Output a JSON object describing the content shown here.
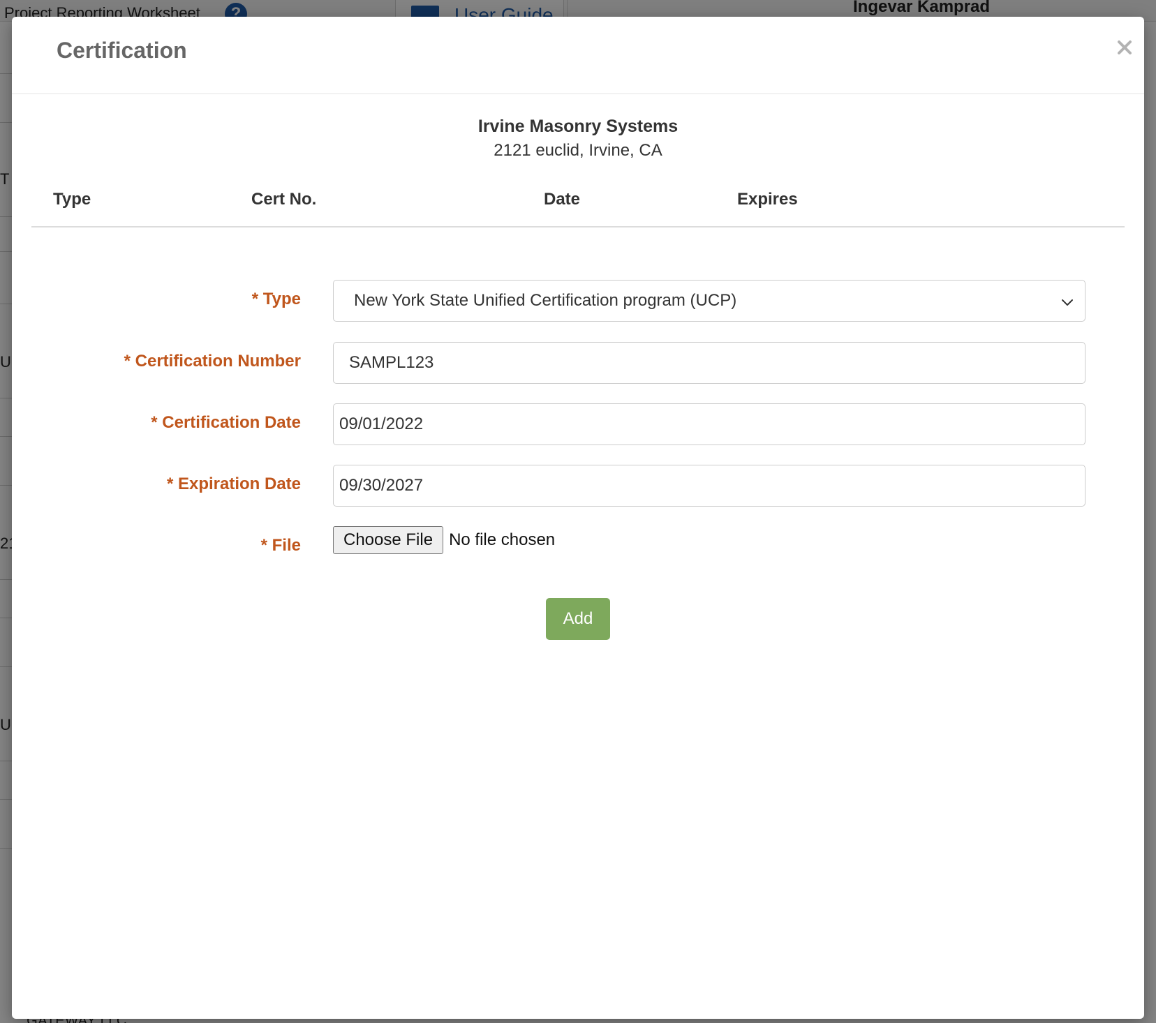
{
  "background": {
    "page_title": "Project Reporting Worksheet",
    "help_icon_glyph": "?",
    "user_guide_label": "User Guide",
    "user_name": "Ingevar Kamprad",
    "edge_fragments": [
      "T",
      "U",
      "21",
      "UC"
    ],
    "bottom_fragment": "...GATEWAY LLC"
  },
  "modal": {
    "title": "Certification",
    "close_glyph": "×"
  },
  "company": {
    "name": "Irvine Masonry Systems",
    "address": "2121 euclid, Irvine, CA"
  },
  "table": {
    "headers": [
      "Type",
      "Cert No.",
      "Date",
      "Expires"
    ]
  },
  "form": {
    "type_label": "* Type",
    "type_value": "New York State Unified Certification program (UCP)",
    "cert_number_label": "* Certification Number",
    "cert_number_value": "SAMPL123",
    "cert_date_label": "* Certification Date",
    "cert_date_value": "09/01/2022",
    "expiration_date_label": "* Expiration Date",
    "expiration_date_value": "09/30/2027",
    "file_label": "* File",
    "file_button_label": "Choose File",
    "file_status": "No file chosen",
    "submit_label": "Add"
  },
  "colors": {
    "label_accent": "#c0561c",
    "submit_button": "#7ea95c",
    "title_text": "#666666",
    "link_blue": "#1f5aa8"
  },
  "icons": {
    "close": "close-icon",
    "select": "chevron-down-icon",
    "help": "help-icon",
    "guide": "book-icon"
  }
}
